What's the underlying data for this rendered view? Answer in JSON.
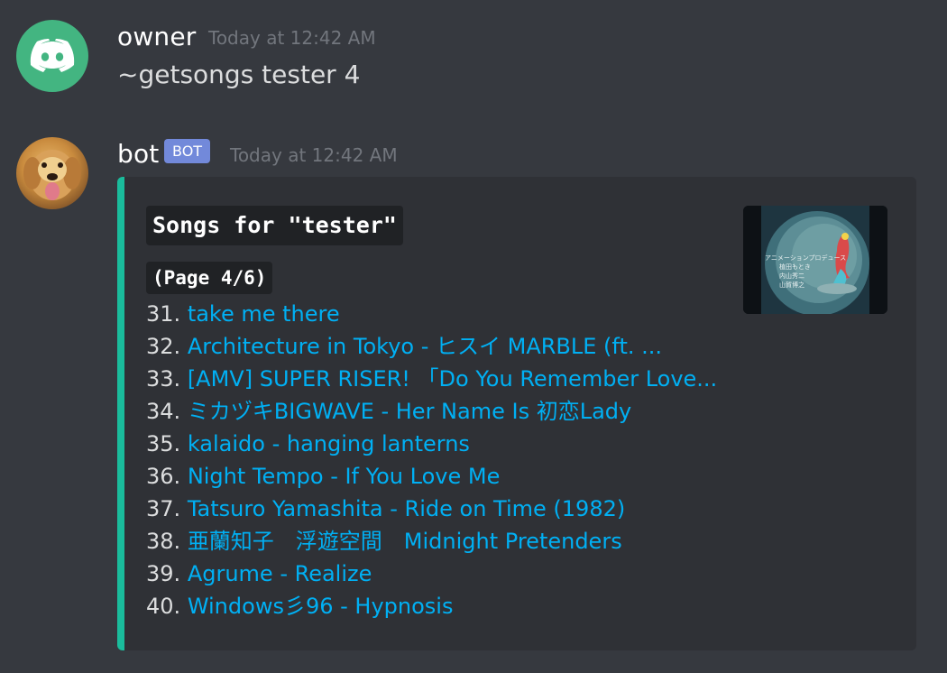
{
  "messages": [
    {
      "author": "owner",
      "timestamp": "Today at 12:42 AM",
      "content": "~getsongs tester 4"
    },
    {
      "author": "bot",
      "badge": "BOT",
      "timestamp": "Today at 12:42 AM"
    }
  ],
  "embed": {
    "accent_color": "#1abc9c",
    "title": "Songs for \"tester\"",
    "page": "(Page 4/6)",
    "thumbnail_text": [
      "アニメーションプロデュース",
      "植田もとき",
      "内山秀二",
      "山賀博之"
    ],
    "songs": [
      {
        "num": "31.",
        "title": "take me there"
      },
      {
        "num": "32.",
        "title": "Architecture in Tokyo - ヒスイ MARBLE (ft. ..."
      },
      {
        "num": "33.",
        "title": "[AMV] SUPER RISER! 「Do You Remember Love..."
      },
      {
        "num": "34.",
        "title": "ミカヅキBIGWAVE - Her Name Is 初恋Lady"
      },
      {
        "num": "35.",
        "title": "kalaido - hanging lanterns"
      },
      {
        "num": "36.",
        "title": "Night Tempo - If You Love Me"
      },
      {
        "num": "37.",
        "title": "Tatsuro Yamashita - Ride on Time (1982)"
      },
      {
        "num": "38.",
        "title": "亜蘭知子　浮遊空間　Midnight Pretenders"
      },
      {
        "num": "39.",
        "title": "Agrume - Realize"
      },
      {
        "num": "40.",
        "title": "Windows彡96 - Hypnosis"
      }
    ]
  },
  "colors": {
    "background": "#36393f",
    "embed_background": "#2f3136",
    "link": "#00b0f4",
    "owner_avatar": "#43b581",
    "bot_badge": "#7289da"
  },
  "icons": {
    "owner_avatar": "discord-logo-icon",
    "bot_avatar": "dog-photo"
  }
}
